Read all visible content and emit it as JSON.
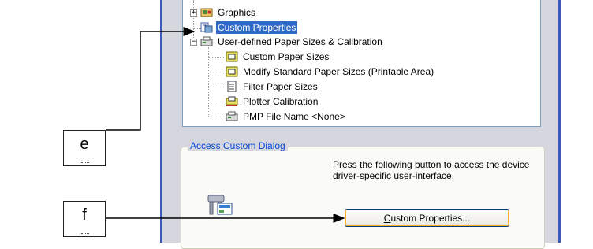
{
  "tree": {
    "items": [
      {
        "label": "Graphics",
        "icon": "graphics-icon",
        "expander": "+",
        "selected": false
      },
      {
        "label": "Custom Properties",
        "icon": "custom-properties-icon",
        "selected": true
      },
      {
        "label": "User-defined Paper Sizes & Calibration",
        "icon": "printer-folder-icon",
        "expander": "−",
        "selected": false
      },
      {
        "label": "Custom Paper Sizes",
        "icon": "paper-size-icon",
        "selected": false
      },
      {
        "label": "Modify Standard Paper Sizes (Printable Area)",
        "icon": "paper-size-icon",
        "selected": false
      },
      {
        "label": "Filter Paper Sizes",
        "icon": "filter-document-icon",
        "selected": false
      },
      {
        "label": "Plotter Calibration",
        "icon": "calibration-icon",
        "selected": false
      },
      {
        "label": "PMP File Name <None>",
        "icon": "pmp-file-icon",
        "selected": false
      }
    ]
  },
  "access_group": {
    "title": "Access Custom Dialog",
    "description": "Press the following button to access the device driver-specific user-interface.",
    "button_label_prefix": "",
    "button_mnemonic": "C",
    "button_label_rest": "ustom Properties..."
  },
  "callouts": {
    "e": "e",
    "f": "f"
  },
  "colors": {
    "selection": "#316ac5",
    "window_frame": "#3b5bb5",
    "group_title": "#0046d5"
  }
}
